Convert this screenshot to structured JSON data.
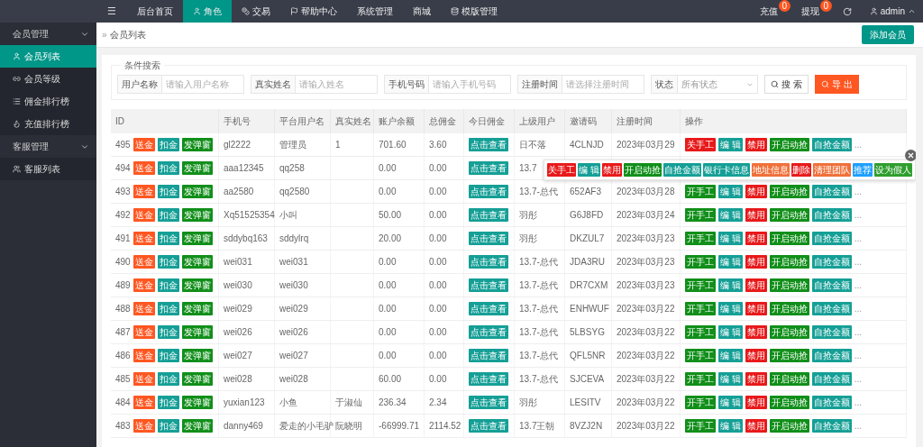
{
  "topbar": {
    "menu_icon": "☰",
    "nav": [
      {
        "label": "后台首页",
        "selected": false
      },
      {
        "label": "角色",
        "selected": true
      },
      {
        "label": "交易",
        "selected": false
      },
      {
        "label": "帮助中心",
        "selected": false
      },
      {
        "label": "系统管理",
        "selected": false
      },
      {
        "label": "商城",
        "selected": false
      },
      {
        "label": "模版管理",
        "selected": false
      }
    ],
    "right": [
      {
        "label": "充值",
        "badge": "0"
      },
      {
        "label": "提现",
        "badge": "0"
      }
    ],
    "user": "admin"
  },
  "sidebar": {
    "groups": [
      {
        "title": "会员管理",
        "expanded": true,
        "items": [
          {
            "label": "会员列表",
            "selected": true
          },
          {
            "label": "会员等级",
            "selected": false
          },
          {
            "label": "佣金排行榜",
            "selected": false
          },
          {
            "label": "充值排行榜",
            "selected": false
          }
        ]
      },
      {
        "title": "客服管理",
        "expanded": true,
        "items": [
          {
            "label": "客服列表",
            "selected": false
          }
        ]
      }
    ]
  },
  "breadcrumb": {
    "mark": "»",
    "text": "会员列表"
  },
  "add_button": "添加会员",
  "search": {
    "legend": "条件搜索",
    "fields": [
      {
        "label": "用户名称",
        "placeholder": "请输入用户名称",
        "kind": "input"
      },
      {
        "label": "真实姓名",
        "placeholder": "请输入姓名",
        "kind": "input"
      },
      {
        "label": "手机号码",
        "placeholder": "请输入手机号码",
        "kind": "input"
      },
      {
        "label": "注册时间",
        "placeholder": "请选择注册时间",
        "kind": "input"
      },
      {
        "label": "状态",
        "placeholder": "所有状态",
        "kind": "select"
      }
    ],
    "search_button": "搜 索",
    "export_button": "导 出"
  },
  "table": {
    "columns": [
      "ID",
      "手机号",
      "平台用户名",
      "真实姓名",
      "账户余额",
      "总佣金",
      "今日佣金",
      "上级用户",
      "邀请码",
      "注册时间",
      "操作"
    ],
    "rows": [
      {
        "id": "495",
        "id_buttons": [
          {
            "label": "送金",
            "color": "#ff5722"
          },
          {
            "label": "扣金",
            "color": "#159f96"
          },
          {
            "label": "发弹窗",
            "color": "#118f1a"
          }
        ],
        "phone": "gl2222",
        "username": "管理员",
        "realname": "1",
        "balance": "701.60",
        "commission": "3.60",
        "view": "点击查看",
        "upline": "日不落",
        "invite": "4CLNJD",
        "registered": "2023年03月29",
        "actions": [
          {
            "label": "关手工",
            "color": "#e8191a"
          },
          {
            "label": "编 辑",
            "color": "#159f96"
          },
          {
            "label": "禁用",
            "color": "#e8191a"
          },
          {
            "label": "开启动抢",
            "color": "#118f1a"
          },
          {
            "label": "自抢金额",
            "color": "#159f96"
          }
        ],
        "more": "..."
      },
      {
        "id": "494",
        "id_buttons": [
          {
            "label": "送金",
            "color": "#ff5722"
          },
          {
            "label": "扣金",
            "color": "#159f96"
          },
          {
            "label": "发弹窗",
            "color": "#118f1a"
          }
        ],
        "phone": "aaa12345",
        "username": "qq258",
        "balance": "0.00",
        "commission": "0.00",
        "view": "点击查看",
        "upline": "13.7",
        "popup": [
          {
            "label": "关手工",
            "color": "#e8191a"
          },
          {
            "label": "编 辑",
            "color": "#159f96"
          },
          {
            "label": "禁用",
            "color": "#e8191a"
          },
          {
            "label": "开启动抢",
            "color": "#118f1a"
          },
          {
            "label": "自抢金额",
            "color": "#159f96"
          },
          {
            "label": "银行卡信息",
            "color": "#159f96"
          },
          {
            "label": "地址信息",
            "color": "#f0703a"
          },
          {
            "label": "删除",
            "color": "#e8191a"
          },
          {
            "label": "清理团队",
            "color": "#f0703a"
          },
          {
            "label": "推荐",
            "color": "#1e9fff"
          },
          {
            "label": "设为假人",
            "color": "#2e9e2e"
          }
        ]
      },
      {
        "id": "493",
        "id_buttons": [
          {
            "label": "送金",
            "color": "#ff5722"
          },
          {
            "label": "扣金",
            "color": "#159f96"
          },
          {
            "label": "发弹窗",
            "color": "#118f1a"
          }
        ],
        "phone": "aa2580",
        "username": "qq2580",
        "balance": "0.00",
        "commission": "0.00",
        "view": "点击查看",
        "upline": "13.7-总代",
        "invite": "652AF3",
        "registered": "2023年03月28",
        "actions": [
          {
            "label": "开手工",
            "color": "#118f1a"
          },
          {
            "label": "编 辑",
            "color": "#159f96"
          },
          {
            "label": "禁用",
            "color": "#e8191a"
          },
          {
            "label": "开启动抢",
            "color": "#118f1a"
          },
          {
            "label": "自抢金额",
            "color": "#159f96"
          }
        ],
        "more": "..."
      },
      {
        "id": "492",
        "id_buttons": [
          {
            "label": "送金",
            "color": "#ff5722"
          },
          {
            "label": "扣金",
            "color": "#159f96"
          },
          {
            "label": "发弹窗",
            "color": "#118f1a"
          }
        ],
        "phone": "Xq51525354",
        "username": "小叫",
        "balance": "50.00",
        "commission": "0.00",
        "view": "点击查看",
        "upline": "羽彤",
        "invite": "G6J8FD",
        "registered": "2023年03月24",
        "actions": [
          {
            "label": "开手工",
            "color": "#118f1a"
          },
          {
            "label": "编 辑",
            "color": "#159f96"
          },
          {
            "label": "禁用",
            "color": "#e8191a"
          },
          {
            "label": "开启动抢",
            "color": "#118f1a"
          },
          {
            "label": "自抢金额",
            "color": "#159f96"
          }
        ],
        "more": "..."
      },
      {
        "id": "491",
        "id_buttons": [
          {
            "label": "送金",
            "color": "#ff5722"
          },
          {
            "label": "扣金",
            "color": "#159f96"
          },
          {
            "label": "发弹窗",
            "color": "#118f1a"
          }
        ],
        "phone": "sddybq163",
        "username": "sddylrq",
        "balance": "20.00",
        "commission": "0.00",
        "view": "点击查看",
        "upline": "羽彤",
        "invite": "DKZUL7",
        "registered": "2023年03月23",
        "actions": [
          {
            "label": "开手工",
            "color": "#118f1a"
          },
          {
            "label": "编 辑",
            "color": "#159f96"
          },
          {
            "label": "禁用",
            "color": "#e8191a"
          },
          {
            "label": "开启动抢",
            "color": "#118f1a"
          },
          {
            "label": "自抢金额",
            "color": "#159f96"
          }
        ],
        "more": "..."
      },
      {
        "id": "490",
        "id_buttons": [
          {
            "label": "送金",
            "color": "#ff5722"
          },
          {
            "label": "扣金",
            "color": "#159f96"
          },
          {
            "label": "发弹窗",
            "color": "#118f1a"
          }
        ],
        "phone": "wei031",
        "username": "wei031",
        "balance": "0.00",
        "commission": "0.00",
        "view": "点击查看",
        "upline": "13.7-总代",
        "invite": "JDA3RU",
        "registered": "2023年03月23",
        "actions": [
          {
            "label": "开手工",
            "color": "#118f1a"
          },
          {
            "label": "编 辑",
            "color": "#159f96"
          },
          {
            "label": "禁用",
            "color": "#e8191a"
          },
          {
            "label": "开启动抢",
            "color": "#118f1a"
          },
          {
            "label": "自抢金额",
            "color": "#159f96"
          }
        ],
        "more": "..."
      },
      {
        "id": "489",
        "id_buttons": [
          {
            "label": "送金",
            "color": "#ff5722"
          },
          {
            "label": "扣金",
            "color": "#159f96"
          },
          {
            "label": "发弹窗",
            "color": "#118f1a"
          }
        ],
        "phone": "wei030",
        "username": "wei030",
        "balance": "0.00",
        "commission": "0.00",
        "view": "点击查看",
        "upline": "13.7-总代",
        "invite": "DR7CXM",
        "registered": "2023年03月23",
        "actions": [
          {
            "label": "开手工",
            "color": "#118f1a"
          },
          {
            "label": "编 辑",
            "color": "#159f96"
          },
          {
            "label": "禁用",
            "color": "#e8191a"
          },
          {
            "label": "开启动抢",
            "color": "#118f1a"
          },
          {
            "label": "自抢金额",
            "color": "#159f96"
          }
        ],
        "more": "..."
      },
      {
        "id": "488",
        "id_buttons": [
          {
            "label": "送金",
            "color": "#ff5722"
          },
          {
            "label": "扣金",
            "color": "#159f96"
          },
          {
            "label": "发弹窗",
            "color": "#118f1a"
          }
        ],
        "phone": "wei029",
        "username": "wei029",
        "balance": "0.00",
        "commission": "0.00",
        "view": "点击查看",
        "upline": "13.7-总代",
        "invite": "ENHWUF",
        "registered": "2023年03月22",
        "actions": [
          {
            "label": "开手工",
            "color": "#118f1a"
          },
          {
            "label": "编 辑",
            "color": "#159f96"
          },
          {
            "label": "禁用",
            "color": "#e8191a"
          },
          {
            "label": "开启动抢",
            "color": "#118f1a"
          },
          {
            "label": "自抢金额",
            "color": "#159f96"
          }
        ],
        "more": "..."
      },
      {
        "id": "487",
        "id_buttons": [
          {
            "label": "送金",
            "color": "#ff5722"
          },
          {
            "label": "扣金",
            "color": "#159f96"
          },
          {
            "label": "发弹窗",
            "color": "#118f1a"
          }
        ],
        "phone": "wei026",
        "username": "wei026",
        "balance": "0.00",
        "commission": "0.00",
        "view": "点击查看",
        "upline": "13.7-总代",
        "invite": "5LBSYG",
        "registered": "2023年03月22",
        "actions": [
          {
            "label": "开手工",
            "color": "#118f1a"
          },
          {
            "label": "编 辑",
            "color": "#159f96"
          },
          {
            "label": "禁用",
            "color": "#e8191a"
          },
          {
            "label": "开启动抢",
            "color": "#118f1a"
          },
          {
            "label": "自抢金额",
            "color": "#159f96"
          }
        ],
        "more": "..."
      },
      {
        "id": "486",
        "id_buttons": [
          {
            "label": "送金",
            "color": "#ff5722"
          },
          {
            "label": "扣金",
            "color": "#159f96"
          },
          {
            "label": "发弹窗",
            "color": "#118f1a"
          }
        ],
        "phone": "wei027",
        "username": "wei027",
        "balance": "0.00",
        "commission": "0.00",
        "view": "点击查看",
        "upline": "13.7-总代",
        "invite": "QFL5NR",
        "registered": "2023年03月22",
        "actions": [
          {
            "label": "开手工",
            "color": "#118f1a"
          },
          {
            "label": "编 辑",
            "color": "#159f96"
          },
          {
            "label": "禁用",
            "color": "#e8191a"
          },
          {
            "label": "开启动抢",
            "color": "#118f1a"
          },
          {
            "label": "自抢金额",
            "color": "#159f96"
          }
        ],
        "more": "..."
      },
      {
        "id": "485",
        "id_buttons": [
          {
            "label": "送金",
            "color": "#ff5722"
          },
          {
            "label": "扣金",
            "color": "#159f96"
          },
          {
            "label": "发弹窗",
            "color": "#118f1a"
          }
        ],
        "phone": "wei028",
        "username": "wei028",
        "balance": "60.00",
        "commission": "0.00",
        "view": "点击查看",
        "upline": "13.7-总代",
        "invite": "SJCEVA",
        "registered": "2023年03月22",
        "actions": [
          {
            "label": "开手工",
            "color": "#118f1a"
          },
          {
            "label": "编 辑",
            "color": "#159f96"
          },
          {
            "label": "禁用",
            "color": "#e8191a"
          },
          {
            "label": "开启动抢",
            "color": "#118f1a"
          },
          {
            "label": "自抢金额",
            "color": "#159f96"
          }
        ],
        "more": "..."
      },
      {
        "id": "484",
        "id_buttons": [
          {
            "label": "送金",
            "color": "#ff5722"
          },
          {
            "label": "扣金",
            "color": "#159f96"
          },
          {
            "label": "发弹窗",
            "color": "#118f1a"
          }
        ],
        "phone": "yuxian123",
        "username": "小鱼",
        "realname": "于淑仙",
        "balance": "236.34",
        "commission": "2.34",
        "view": "点击查看",
        "upline": "羽彤",
        "invite": "LESITV",
        "registered": "2023年03月22",
        "actions": [
          {
            "label": "开手工",
            "color": "#118f1a"
          },
          {
            "label": "编 辑",
            "color": "#159f96"
          },
          {
            "label": "禁用",
            "color": "#e8191a"
          },
          {
            "label": "开启动抢",
            "color": "#118f1a"
          },
          {
            "label": "自抢金额",
            "color": "#159f96"
          }
        ],
        "more": "..."
      },
      {
        "id": "483",
        "id_buttons": [
          {
            "label": "送金",
            "color": "#ff5722"
          },
          {
            "label": "扣金",
            "color": "#159f96"
          },
          {
            "label": "发弹窗",
            "color": "#118f1a"
          }
        ],
        "phone": "danny469",
        "username": "爱走的小毛驴",
        "realname": "阮晓明",
        "balance": "-66999.71",
        "commission": "2114.52",
        "view": "点击查看",
        "upline": "13.7王朝",
        "invite": "8VZJ2N",
        "registered": "2023年03月22",
        "actions": [
          {
            "label": "开手工",
            "color": "#118f1a"
          },
          {
            "label": "编 辑",
            "color": "#159f96"
          },
          {
            "label": "禁用",
            "color": "#e8191a"
          },
          {
            "label": "开启动抢",
            "color": "#118f1a"
          },
          {
            "label": "自抢金额",
            "color": "#159f96"
          }
        ],
        "more": "..."
      }
    ]
  }
}
